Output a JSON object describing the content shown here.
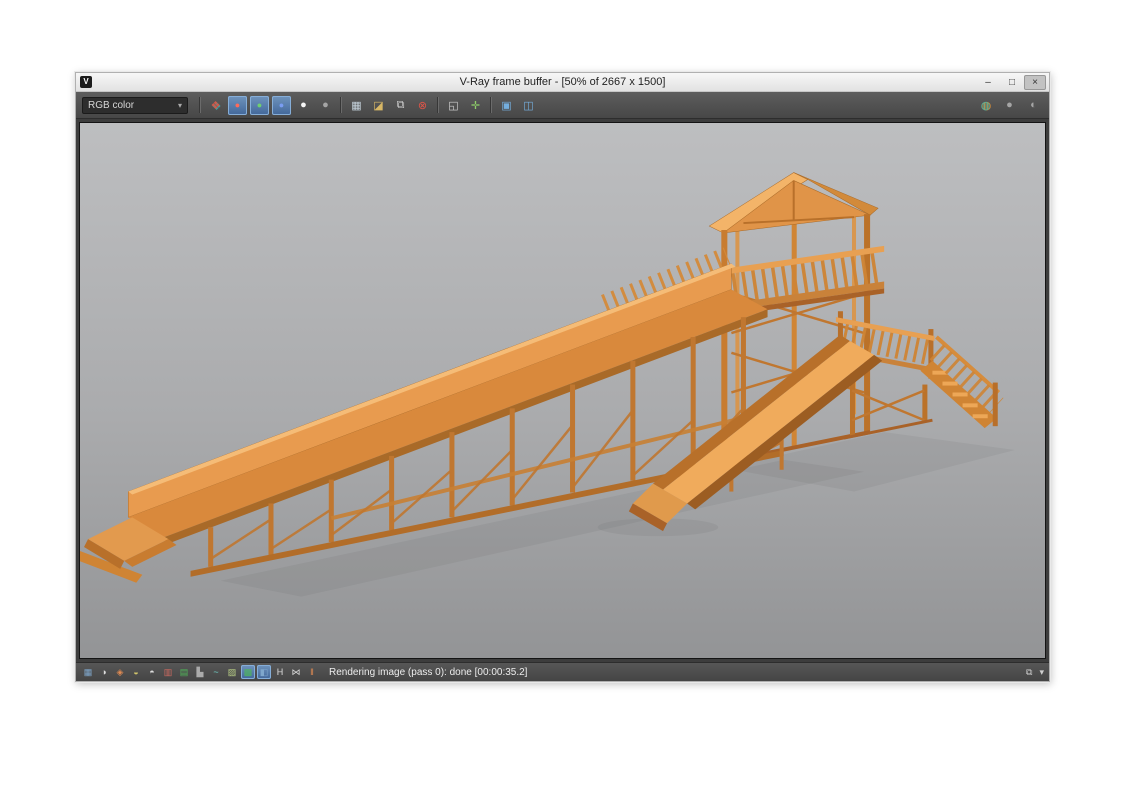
{
  "window": {
    "title": "V-Ray frame buffer - [50% of 2667 x 1500]",
    "app_icon_glyph": "V",
    "controls": {
      "minimize": "–",
      "maximize": "□",
      "close": "×"
    }
  },
  "toolbar": {
    "channel_dropdown": {
      "value": "RGB color",
      "arrow": "▾"
    },
    "icons": [
      {
        "name": "view-channels-icon",
        "glyph": "❖"
      },
      {
        "name": "red-channel-button",
        "glyph": "●"
      },
      {
        "name": "green-channel-button",
        "glyph": "●"
      },
      {
        "name": "blue-channel-button",
        "glyph": "●"
      },
      {
        "name": "alpha-channel-button",
        "glyph": "●"
      },
      {
        "name": "monochrome-button",
        "glyph": "●"
      },
      {
        "name": "save-image-button",
        "glyph": "▦"
      },
      {
        "name": "load-image-button",
        "glyph": "◪"
      },
      {
        "name": "duplicate-to-host-button",
        "glyph": "⧉"
      },
      {
        "name": "clear-image-button",
        "glyph": "⊗"
      },
      {
        "name": "region-render-button",
        "glyph": "◱"
      },
      {
        "name": "track-mouse-button",
        "glyph": "✛"
      },
      {
        "name": "show-corrections-button",
        "glyph": "▣"
      },
      {
        "name": "pixel-information-button",
        "glyph": "◫"
      }
    ],
    "right_icons": [
      {
        "name": "render-last-button",
        "glyph": "◍"
      },
      {
        "name": "lens-effects-button",
        "glyph": "●"
      },
      {
        "name": "vfb-settings-button",
        "glyph": "◐"
      }
    ]
  },
  "viewport": {
    "description": "Rendered 3D image of a wooden playground slide: long inclined ramp on truss supports, covered lookout tower with gabled roof, short secondary slide and access stairs, on a neutral gray gradient background."
  },
  "statusbar": {
    "icons": [
      {
        "name": "force-color-clamping-icon",
        "glyph": "▦"
      },
      {
        "name": "view-clamped-colors-icon",
        "glyph": "◑"
      },
      {
        "name": "pixel-info-icon",
        "glyph": "◈"
      },
      {
        "name": "exposure-icon",
        "glyph": "◒"
      },
      {
        "name": "white-balance-icon",
        "glyph": "◓"
      },
      {
        "name": "hue-saturation-icon",
        "glyph": "▥"
      },
      {
        "name": "color-balance-icon",
        "glyph": "▤"
      },
      {
        "name": "levels-icon",
        "glyph": "▙"
      },
      {
        "name": "curves-icon",
        "glyph": "~"
      },
      {
        "name": "background-image-icon",
        "glyph": "▨"
      },
      {
        "name": "lut-icon",
        "glyph": "▩"
      },
      {
        "name": "ocio-icon",
        "glyph": "◧"
      },
      {
        "name": "history-icon",
        "glyph": "H"
      },
      {
        "name": "compare-icon",
        "glyph": "⋈"
      },
      {
        "name": "ab-split-icon",
        "glyph": "‖"
      }
    ],
    "status_text": "Rendering image (pass 0): done [00:00:35.2]",
    "right_icons": [
      {
        "name": "detach-icon",
        "glyph": "⧉"
      },
      {
        "name": "collapse-icon",
        "glyph": "▾"
      }
    ]
  }
}
